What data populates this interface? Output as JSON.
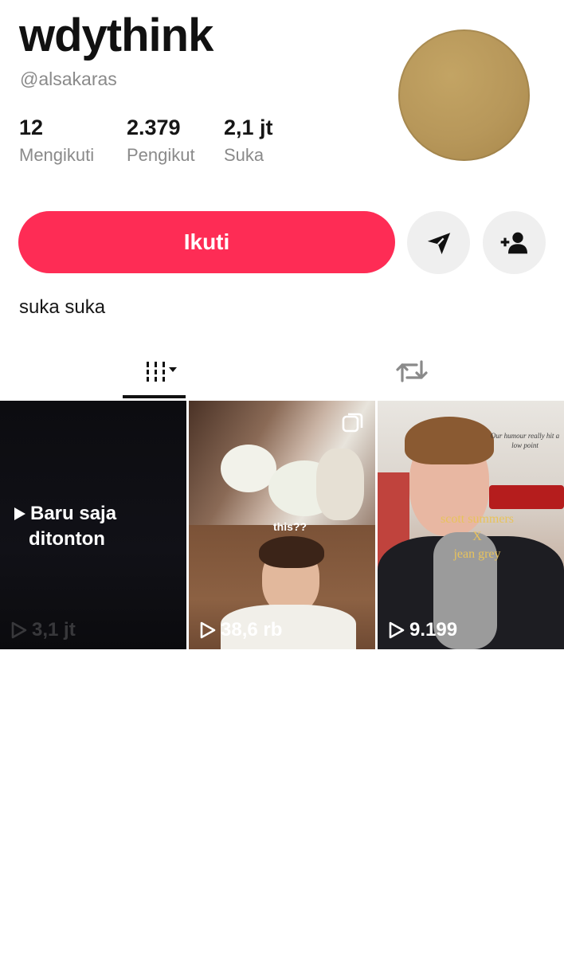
{
  "profile": {
    "name": "wdythink",
    "handle": "@alsakaras",
    "bio": "suka suka"
  },
  "stats": [
    {
      "value": "12",
      "label": "Mengikuti"
    },
    {
      "value": "2.379",
      "label": "Pengikut"
    },
    {
      "value": "2,1 jt",
      "label": "Suka"
    }
  ],
  "actions": {
    "follow_label": "Ikuti",
    "send_icon": "paper-plane-icon",
    "add_friend_icon": "add-person-icon"
  },
  "tabs": [
    {
      "name": "videos",
      "icon": "grid-bars-icon",
      "active": true
    },
    {
      "name": "reposts",
      "icon": "repost-icon",
      "active": false
    }
  ],
  "videos": [
    {
      "overlay": "Baru saja ditonton",
      "overlay_line1": "Baru saja",
      "overlay_line2": "ditonton",
      "views": "3,1 jt"
    },
    {
      "caption": "this??",
      "views": "38,6 rb",
      "badge": "multi-photo-icon"
    },
    {
      "caption_top": "Our humour really hit a low point",
      "caption_mid1": "scott summers",
      "caption_mid2": "X",
      "caption_mid3": "jean grey",
      "views": "9.199"
    }
  ],
  "colors": {
    "accent": "#fe2c55",
    "muted": "#8a8a8a"
  }
}
